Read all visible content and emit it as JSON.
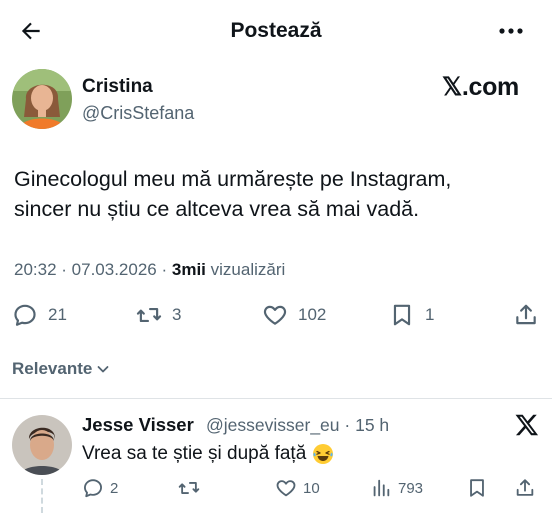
{
  "header": {
    "title": "Postează"
  },
  "post": {
    "author_name": "Cristina",
    "author_handle": "@CrisStefana",
    "source_badge": "𝕏.com",
    "text": "Ginecologul meu mă urmărește pe Instagram,\nsincer nu știu ce altceva vrea să mai vadă.",
    "time": "20:32",
    "date": "07.03.2026",
    "views_count": "3mii",
    "views_label": "vizualizări",
    "replies": "21",
    "reposts": "3",
    "likes": "102",
    "bookmarks": "1"
  },
  "filter": {
    "label": "Relevante"
  },
  "reply": {
    "author_name": "Jesse Visser",
    "author_handle": "@jessevisser_eu",
    "time": "15 h",
    "text": "Vrea sa te știe și după față",
    "replies": "2",
    "reposts": "",
    "likes": "10",
    "views": "793"
  },
  "colors": {
    "text": "#0f1419",
    "secondary": "#536471",
    "divider": "#dfe3e6"
  }
}
